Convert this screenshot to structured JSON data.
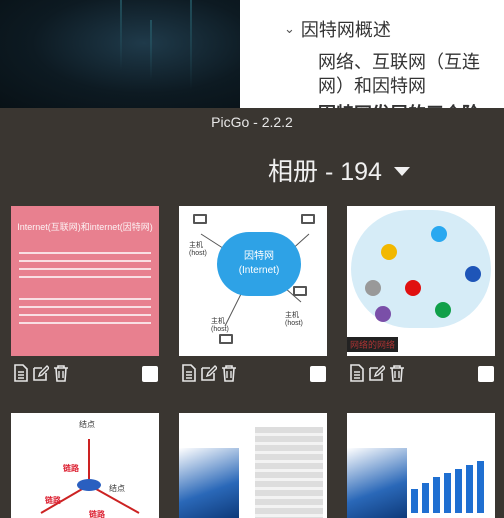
{
  "doc": {
    "toc_heading": "因特网概述",
    "toc_item": "网络、互联网（互连网）和因特网",
    "toc_item_partial": "因特网发展的三个阶"
  },
  "window": {
    "title": "PicGo - 2.2.2"
  },
  "gallery": {
    "title": "相册 - 194"
  },
  "images": [
    {
      "caption": "Internet(互联网)和internet(因特网)"
    },
    {
      "cloud_label": "因特网\n(Internet)",
      "host_label": "主机\n(host)"
    },
    {
      "caption": "网络的网络"
    },
    {
      "node": "结点",
      "link": "链路"
    },
    {},
    {}
  ],
  "colors": {
    "background": "#3a3631",
    "checkbox": "#ffffff",
    "icon": "#e6e6e6"
  }
}
